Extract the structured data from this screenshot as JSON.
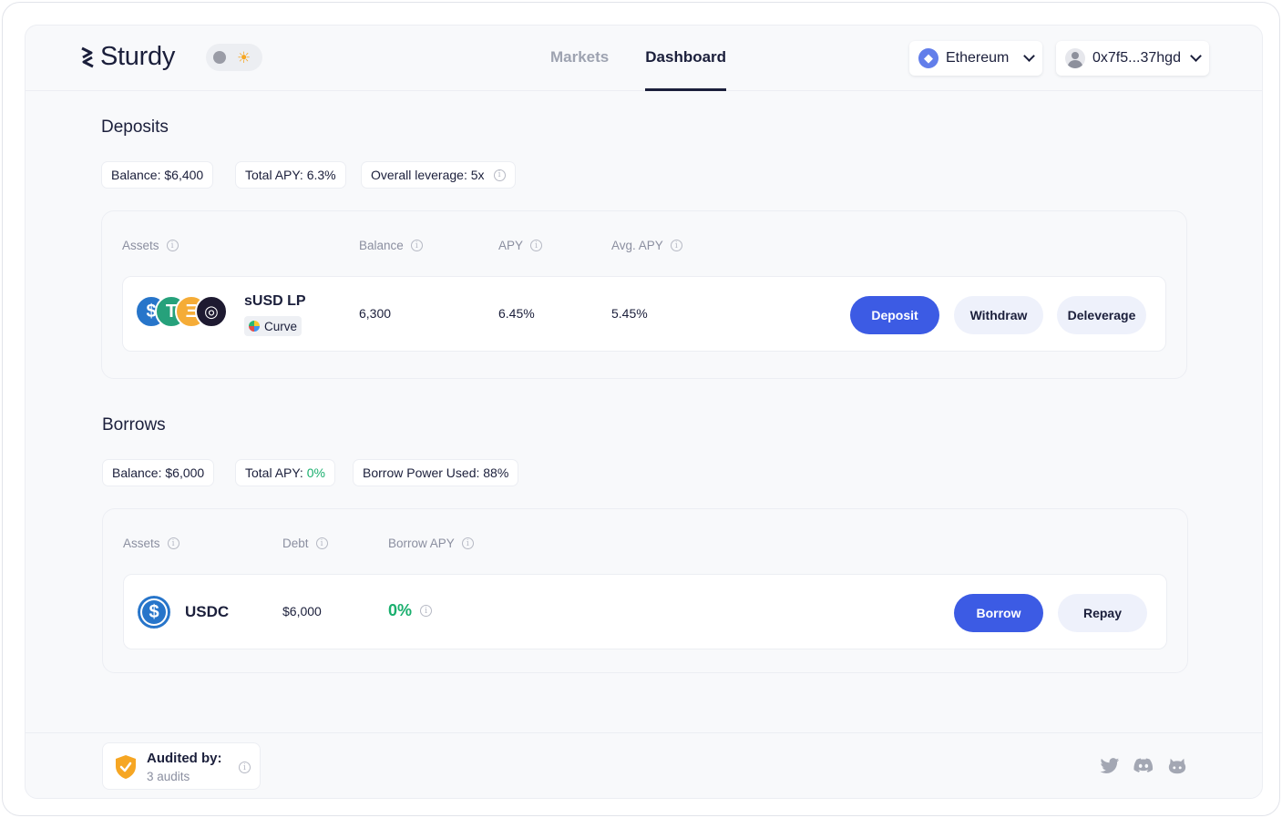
{
  "brand": {
    "name": "Sturdy"
  },
  "nav": {
    "tabs": [
      {
        "label": "Markets"
      },
      {
        "label": "Dashboard"
      }
    ]
  },
  "network": {
    "label": "Ethereum",
    "icon": "ethereum-icon"
  },
  "account": {
    "address": "0x7f5...37hgd"
  },
  "colors": {
    "accent": "#3c5be4",
    "positive": "#1aaf6e",
    "text": "#1b1f3b",
    "muted": "#8b8fa0"
  },
  "deposits": {
    "title": "Deposits",
    "stats": {
      "balance": "Balance: $6,400",
      "total_apy": "Total APY: 6.3%",
      "leverage": "Overall leverage: 5x"
    },
    "columns": {
      "assets": "Assets",
      "balance": "Balance",
      "apy": "APY",
      "avg_apy": "Avg. APY"
    },
    "rows": [
      {
        "asset": "sUSD LP",
        "platform": "Curve",
        "balance": "6,300",
        "apy": "6.45%",
        "avg_apy": "5.45%",
        "actions": {
          "deposit": "Deposit",
          "withdraw": "Withdraw",
          "deleverage": "Deleverage"
        }
      }
    ]
  },
  "borrows": {
    "title": "Borrows",
    "stats": {
      "balance": "Balance: $6,000",
      "total_apy_label": "Total APY: ",
      "total_apy_value": "0%",
      "power": "Borrow Power Used: 88%"
    },
    "columns": {
      "assets": "Assets",
      "debt": "Debt",
      "borrow_apy": "Borrow APY"
    },
    "rows": [
      {
        "asset": "USDC",
        "debt": "$6,000",
        "borrow_apy": "0%",
        "actions": {
          "borrow": "Borrow",
          "repay": "Repay"
        }
      }
    ]
  },
  "footer": {
    "audit_title": "Audited by:",
    "audit_count": "3 audits",
    "social": [
      "twitter-icon",
      "discord-icon",
      "github-icon"
    ]
  }
}
